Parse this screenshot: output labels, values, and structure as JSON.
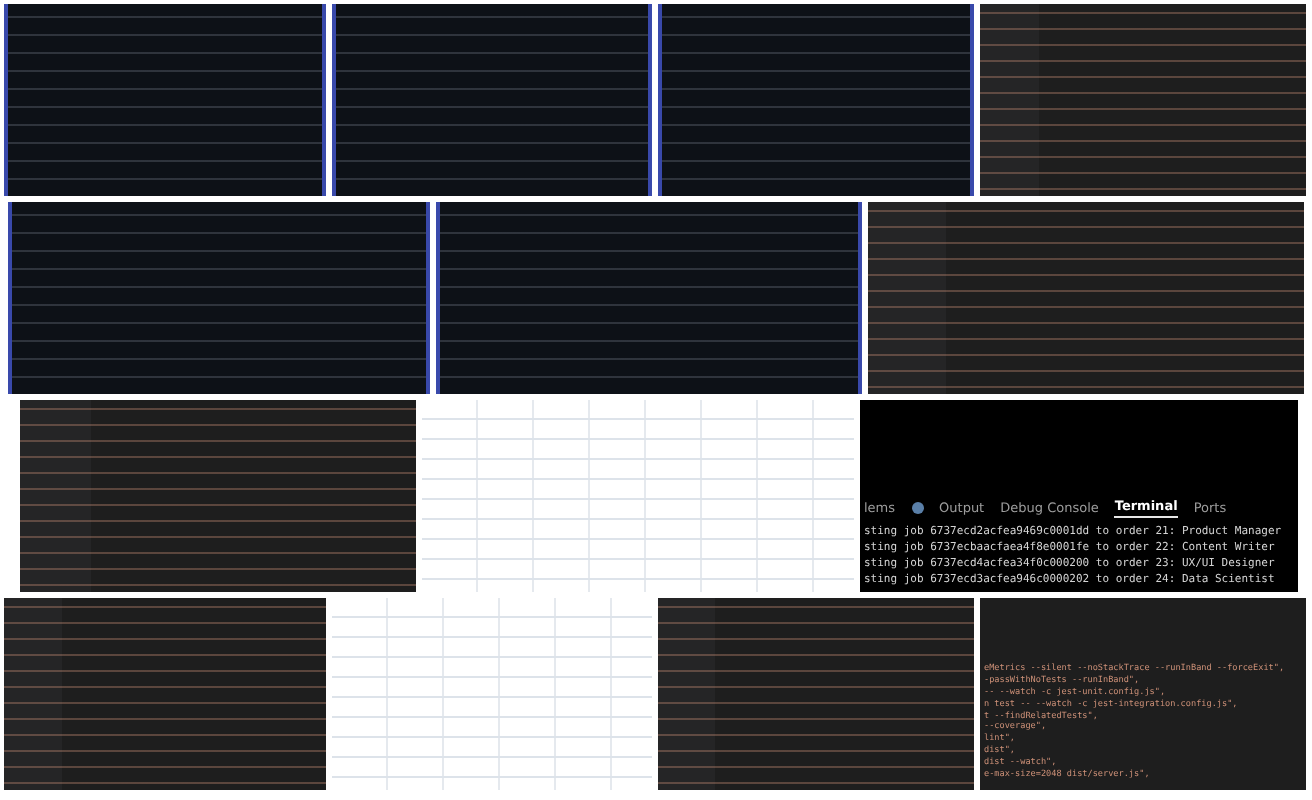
{
  "rows": [
    {
      "tiles": [
        {
          "kind": "dark-page"
        },
        {
          "kind": "dark-page"
        },
        {
          "kind": "dark-page"
        },
        {
          "kind": "code-editor"
        }
      ]
    },
    {
      "tiles": [
        {
          "kind": "dark-page"
        },
        {
          "kind": "dark-page"
        },
        {
          "kind": "code-editor"
        }
      ]
    },
    {
      "tiles": [
        {
          "kind": "code-editor"
        },
        {
          "kind": "table-app"
        },
        {
          "kind": "terminal",
          "tabs": [
            {
              "label": "lems",
              "selected": false
            },
            {
              "label": "Output",
              "selected": false
            },
            {
              "label": "Debug Console",
              "selected": false
            },
            {
              "label": "Terminal",
              "selected": true
            },
            {
              "label": "Ports",
              "selected": false
            }
          ],
          "lines": [
            "sting job 6737ecd2acfea9469c0001dd to order 21: Product Manager",
            "sting job 6737ecbaacfaea4f8e0001fe to order 22: Content Writer",
            "sting job 6737ecd4acfea34f0c000200 to order 23: UX/UI Designer",
            "sting job 6737ecd3acfea946c0000202 to order 24: Data Scientist"
          ]
        }
      ]
    },
    {
      "tiles": [
        {
          "kind": "code-editor"
        },
        {
          "kind": "table-app"
        },
        {
          "kind": "code-editor"
        },
        {
          "kind": "code-zoom",
          "lines": [
            "eMetrics --silent --noStackTrace --runInBand --forceExit\",",
            "-passWithNoTests --runInBand\",",
            "-- --watch -c jest-unit.config.js\",",
            "n test -- --watch -c jest-integration.config.js\",",
            "t --findRelatedTests\",",
            "--coverage\",",
            "lint\",",
            "dist\",",
            "dist --watch\",",
            "e-max-size=2048 dist/server.js\","
          ]
        }
      ]
    }
  ]
}
